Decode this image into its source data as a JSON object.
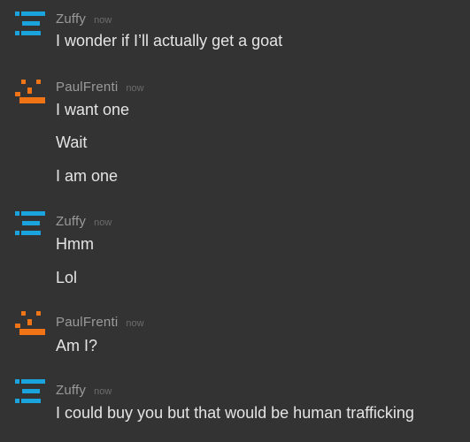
{
  "messages": [
    {
      "username": "Zuffy",
      "timestamp": "now",
      "avatar_icon": "blue-identicon",
      "avatar_color": "#1aa3dc",
      "lines": [
        "I wonder if I’ll actually get a goat"
      ]
    },
    {
      "username": "PaulFrenti",
      "timestamp": "now",
      "avatar_icon": "orange-identicon",
      "avatar_color": "#f07416",
      "lines": [
        "I want one",
        "Wait",
        "I am one"
      ]
    },
    {
      "username": "Zuffy",
      "timestamp": "now",
      "avatar_icon": "blue-identicon",
      "avatar_color": "#1aa3dc",
      "lines": [
        "Hmm",
        "Lol"
      ]
    },
    {
      "username": "PaulFrenti",
      "timestamp": "now",
      "avatar_icon": "orange-identicon",
      "avatar_color": "#f07416",
      "lines": [
        "Am I?"
      ]
    },
    {
      "username": "Zuffy",
      "timestamp": "now",
      "avatar_icon": "blue-identicon",
      "avatar_color": "#1aa3dc",
      "lines": [
        "I could buy you but that would be human trafficking"
      ]
    }
  ]
}
